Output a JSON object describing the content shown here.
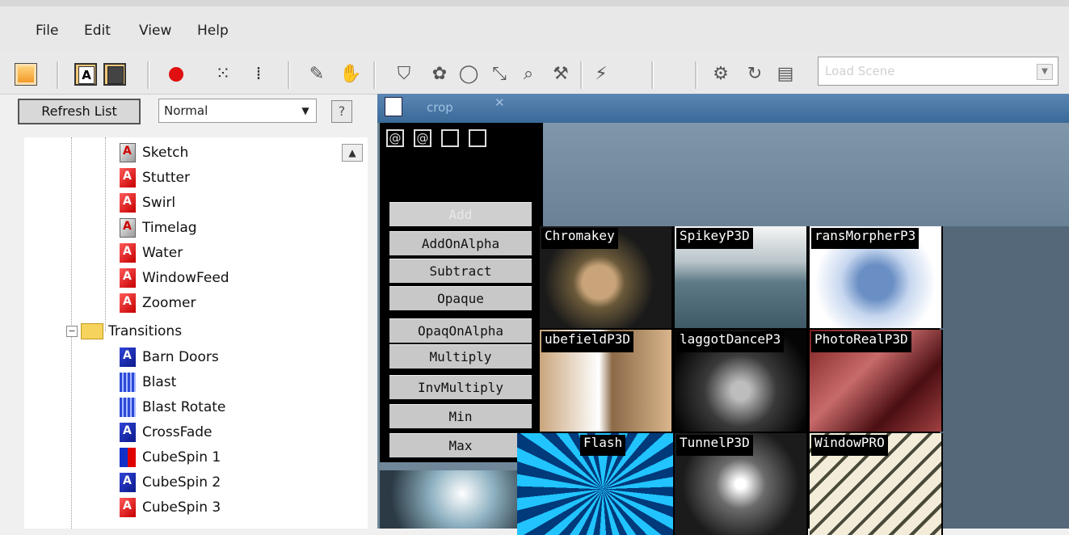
{
  "menu": [
    {
      "label": "File"
    },
    {
      "label": "Edit"
    },
    {
      "label": "View"
    },
    {
      "label": "Help"
    }
  ],
  "toolbar": {
    "scene_placeholder": "Load Scene"
  },
  "left_panel": {
    "refresh_label": "Refresh List",
    "mode_value": "Normal",
    "help_label": "?",
    "tree": [
      {
        "label": "Sketch",
        "icon": "gray"
      },
      {
        "label": "Stutter",
        "icon": "red"
      },
      {
        "label": "Swirl",
        "icon": "red"
      },
      {
        "label": "Timelag",
        "icon": "gray"
      },
      {
        "label": "Water",
        "icon": "red"
      },
      {
        "label": "WindowFeed",
        "icon": "red"
      },
      {
        "label": "Zoomer",
        "icon": "red"
      },
      {
        "label": "Transitions",
        "icon": "folder"
      },
      {
        "label": "Barn Doors",
        "icon": "blue"
      },
      {
        "label": "Blast",
        "icon": "bluegrid"
      },
      {
        "label": "Blast Rotate",
        "icon": "bluegrid"
      },
      {
        "label": "CrossFade",
        "icon": "blue"
      },
      {
        "label": "CubeSpin 1",
        "icon": "redmix"
      },
      {
        "label": "CubeSpin 2",
        "icon": "blue"
      },
      {
        "label": "CubeSpin 3",
        "icon": "red"
      }
    ]
  },
  "viewer": {
    "header_title": "crop",
    "blend_modes": [
      "Add",
      "AddOnAlpha",
      "Subtract",
      "Opaque",
      "OpaqOnAlpha",
      "Multiply",
      "InvMultiply",
      "Min",
      "Max"
    ],
    "thumbnails": [
      {
        "label": "Chromakey"
      },
      {
        "label": "SpikeyP3D"
      },
      {
        "label": "ransMorpherP3"
      },
      {
        "label": "ubefieldP3D"
      },
      {
        "label": "laggotDanceP3"
      },
      {
        "label": "PhotoRealP3D"
      },
      {
        "label": "Flash"
      },
      {
        "label": "TunnelP3D"
      },
      {
        "label": "WindowPRO"
      }
    ]
  },
  "colors": {
    "panel_blue": "#3b6a98",
    "record_red": "#e01010"
  }
}
